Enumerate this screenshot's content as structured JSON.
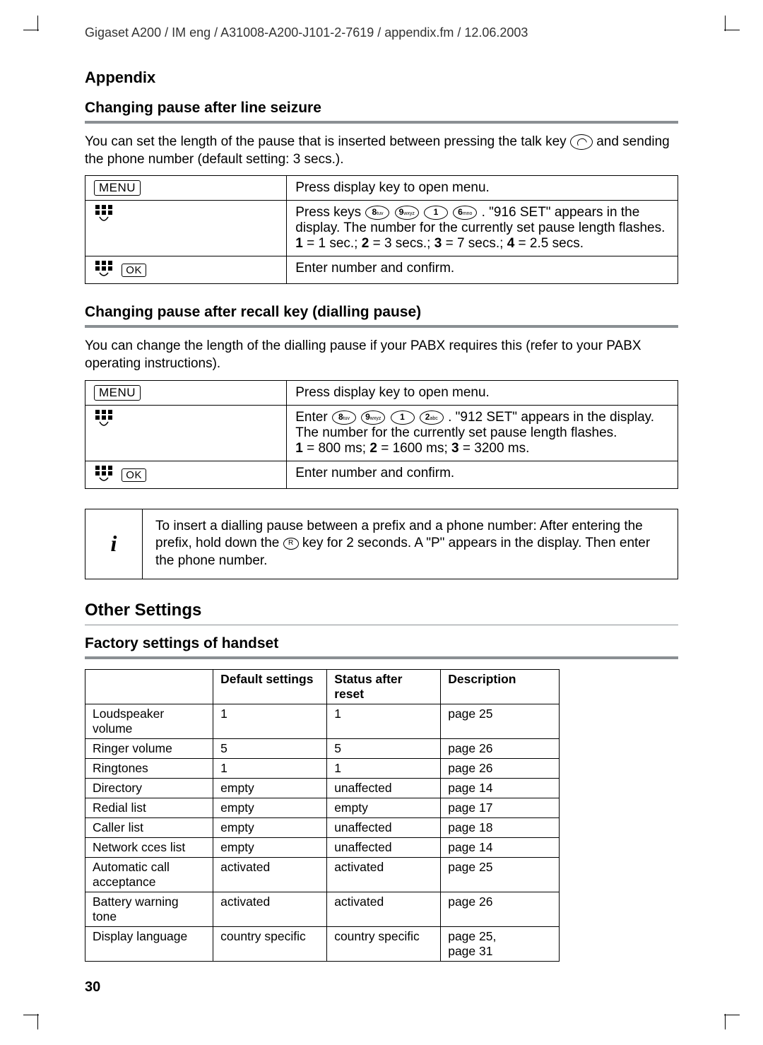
{
  "header": "Gigaset A200 / IM eng / A31008-A200-J101-2-7619 / appendix.fm / 12.06.2003",
  "section_title": "Appendix",
  "sub1": {
    "title": "Changing pause after line seizure",
    "intro_a": "You can set the length of the pause that is inserted between pressing the talk key ",
    "intro_b": " and sending the phone number (default setting: 3 secs.).",
    "row1_left": "MENU",
    "row1_right": "Press display key to open menu.",
    "row2_right_a": "Press keys ",
    "row2_right_b": ". \"916 SET\" appears in the display. The number for the currently set pause length flashes. ",
    "row2_right_c": "1",
    "row2_right_d": " = 1 sec.; ",
    "row2_right_e": "2",
    "row2_right_f": " = 3 secs.; ",
    "row2_right_g": "3",
    "row2_right_h": " = 7 secs.; ",
    "row2_right_i": "4",
    "row2_right_j": " = 2.5 secs.",
    "row3_ok": "OK",
    "row3_right": "Enter number and confirm.",
    "keys": [
      "8 tuv",
      "9 wxyz",
      "1",
      "6 mno"
    ]
  },
  "sub2": {
    "title": "Changing pause after recall key (dialling pause)",
    "intro": "You can change the length of the dialling pause if your PABX requires this (refer to your PABX operating instructions).",
    "row1_left": "MENU",
    "row1_right": "Press display key to open menu.",
    "row2_right_a": "Enter ",
    "row2_right_b": ". \"912 SET\" appears in the display. The number for the currently set pause length flashes.",
    "row2_right_c": "1",
    "row2_right_d": " = 800 ms; ",
    "row2_right_e": "2",
    "row2_right_f": " = 1600 ms; ",
    "row2_right_g": "3",
    "row2_right_h": " = 3200 ms.",
    "row3_ok": "OK",
    "row3_right": "Enter number and confirm.",
    "keys": [
      "8 tuv",
      "9 wxyz",
      "1",
      "2 abc"
    ]
  },
  "info": {
    "icon": "i",
    "text_a": "To insert a dialling pause between a prefix and a phone number: After entering the prefix, hold down the ",
    "text_b": " key for 2 seconds. A \"P\" appears in the display. Then enter the phone number.",
    "r_label": "R"
  },
  "other_title": "Other Settings",
  "factory_title": "Factory settings of handset",
  "settings_headers": [
    "",
    "Default settings",
    "Status after reset",
    "Description"
  ],
  "settings_rows": [
    [
      "Loudspeaker volume",
      "1",
      "1",
      "page 25"
    ],
    [
      "Ringer volume",
      "5",
      "5",
      "page 26"
    ],
    [
      "Ringtones",
      "1",
      "1",
      "page 26"
    ],
    [
      "Directory",
      "empty",
      "unaffected",
      "page 14"
    ],
    [
      "Redial list",
      "empty",
      "empty",
      "page 17"
    ],
    [
      "Caller list",
      "empty",
      "unaffected",
      "page 18"
    ],
    [
      "Network cces list",
      "empty",
      "unaffected",
      "page 14"
    ],
    [
      "Automatic call acceptance",
      "activated",
      "activated",
      "page 25"
    ],
    [
      "Battery warning tone",
      "activated",
      "activated",
      "page 26"
    ],
    [
      "Display language",
      "country specific",
      "country specific",
      "page 25, page 31"
    ]
  ],
  "page_number": "30"
}
